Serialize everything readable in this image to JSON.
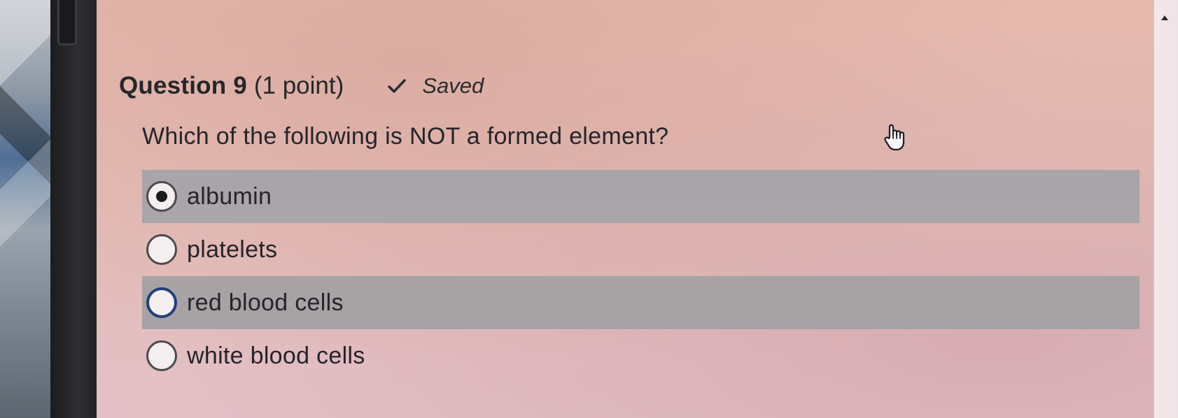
{
  "question": {
    "title": "Question 9",
    "points": "(1 point)",
    "status": "Saved",
    "status_icon": "check-icon",
    "text": "Which of the following is NOT a formed element?"
  },
  "options": [
    {
      "label": "albumin",
      "selected": true
    },
    {
      "label": "platelets",
      "selected": false
    },
    {
      "label": "red blood cells",
      "selected": false
    },
    {
      "label": "white blood cells",
      "selected": false
    }
  ],
  "cursor_icon": "hand-pointer-icon",
  "colors": {
    "screen_background": "#e5bdb7",
    "highlight_row": "#a9a4a8",
    "focus_ring": "#1f3f78",
    "text": "#25252a"
  }
}
